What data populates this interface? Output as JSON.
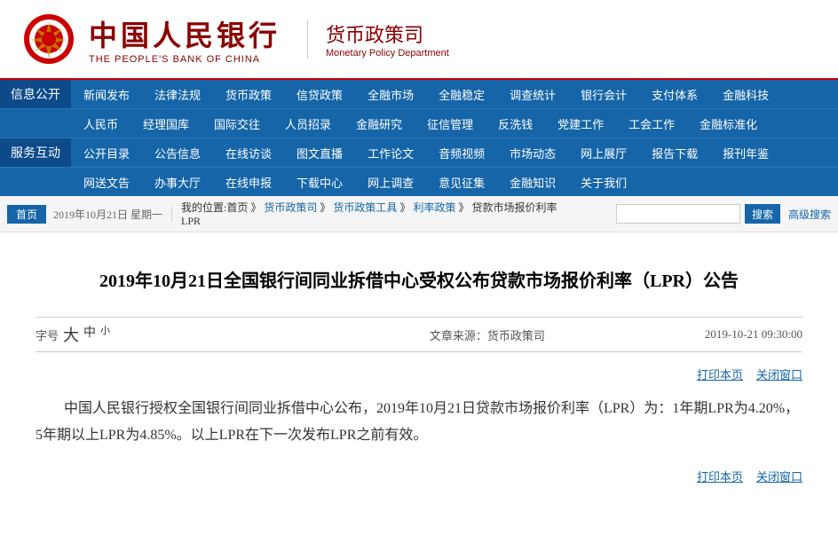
{
  "header": {
    "logo_cn": "中国人民银行",
    "logo_en": "THE PEOPLE'S BANK OF CHINA",
    "dept_cn": "货币政策司",
    "dept_en": "Monetary Policy Department"
  },
  "nav": {
    "section1_label": "信息公开",
    "section2_label": "服务互动",
    "row1": [
      {
        "label": "新闻发布"
      },
      {
        "label": "法律法规"
      },
      {
        "label": "货币政策"
      },
      {
        "label": "信贷政策"
      },
      {
        "label": "全融市场"
      },
      {
        "label": "全融稳定"
      },
      {
        "label": "调查统计"
      },
      {
        "label": "银行会计"
      },
      {
        "label": "支付体系"
      },
      {
        "label": "金融科技"
      }
    ],
    "row2": [
      {
        "label": "人民币"
      },
      {
        "label": "经理国库"
      },
      {
        "label": "国际交往"
      },
      {
        "label": "人员招录"
      },
      {
        "label": "金融研究"
      },
      {
        "label": "征信管理"
      },
      {
        "label": "反洗钱"
      },
      {
        "label": "党建工作"
      },
      {
        "label": "工会工作"
      },
      {
        "label": "金融标准化"
      }
    ],
    "row3": [
      {
        "label": "公开目录"
      },
      {
        "label": "公告信息"
      },
      {
        "label": "在线访谈"
      },
      {
        "label": "图文直播"
      },
      {
        "label": "工作论文"
      },
      {
        "label": "音频视频"
      },
      {
        "label": "市场动态"
      },
      {
        "label": "网上展厅"
      },
      {
        "label": "报告下载"
      },
      {
        "label": "报刊年鉴"
      }
    ],
    "row4": [
      {
        "label": "网送文告"
      },
      {
        "label": "办事大厅"
      },
      {
        "label": "在线申报"
      },
      {
        "label": "下载中心"
      },
      {
        "label": "网上调查"
      },
      {
        "label": "意见征集"
      },
      {
        "label": "金融知识"
      },
      {
        "label": "关于我们"
      }
    ]
  },
  "breadcrumb": {
    "home": "首页",
    "date": "2019年10月21日 星期一",
    "my_position": "我的位置:首页",
    "separator": "》",
    "path": [
      "货币政策司",
      "货币政策工具",
      "利率政策",
      "贷款市场报价利率"
    ],
    "sub_label": "LPR"
  },
  "search": {
    "placeholder": "",
    "btn_label": "搜索",
    "advanced_label": "高级搜索"
  },
  "article": {
    "title": "2019年10月21日全国银行间同业拆借中心受权公布贷款市场报价利率（LPR）公告",
    "font_size_label": "字号",
    "font_large": "大",
    "font_medium": "中",
    "font_small": "小",
    "source_label": "文章来源：",
    "source": "货币政策司",
    "date": "2019-10-21  09:30:00",
    "print_label": "打印本页",
    "close_label": "关闭窗口",
    "body": "中国人民银行授权全国银行间同业拆借中心公布，2019年10月21日贷款市场报价利率（LPR）为：1年期LPR为4.20%，5年期以上LPR为4.85%。以上LPR在下一次发布LPR之前有效。"
  }
}
